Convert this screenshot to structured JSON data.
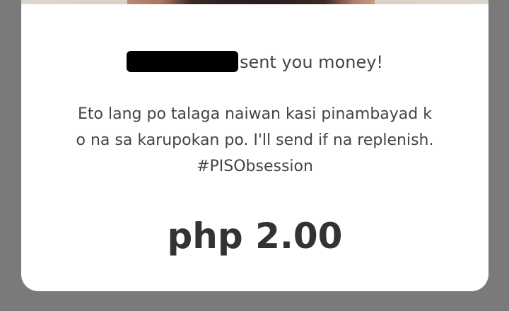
{
  "notification": {
    "sender_name": "[redacted]",
    "sent_text": "sent you money!",
    "message_lines": [
      "Eto lang po talaga naiwan kasi pinambayad k",
      "o na sa karupokan po. I'll send if na replenish.",
      "#PISObsession"
    ],
    "amount": "php 2.00"
  },
  "colors": {
    "backdrop": "#7a7a7a",
    "card": "#ffffff",
    "text": "#444444",
    "amount_text": "#333333",
    "redaction": "#000000"
  }
}
